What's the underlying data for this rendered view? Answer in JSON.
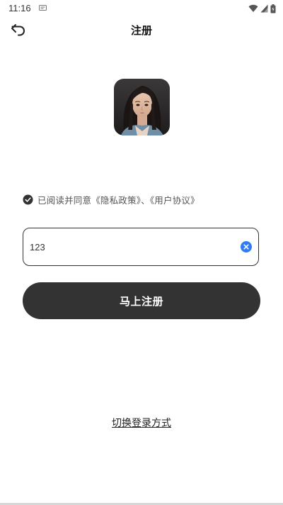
{
  "status_bar": {
    "time": "11:16",
    "icons": [
      "notification-icon",
      "wifi-icon",
      "signal-icon",
      "battery-icon"
    ]
  },
  "header": {
    "title": "注册",
    "back_icon": "back-arrow-icon"
  },
  "avatar": {
    "icon": "app-avatar"
  },
  "agreement": {
    "checked": true,
    "prefix": "已阅读并同意",
    "privacy_link": "《隐私政策》",
    "separator": "、",
    "user_agreement_link": "《用户协议》"
  },
  "input": {
    "value": "123",
    "clear_icon": "clear-icon"
  },
  "register_button": {
    "label": "马上注册"
  },
  "switch_login": {
    "label": "切换登录方式"
  },
  "colors": {
    "primary_dark": "#333333",
    "clear_blue": "#2e7cf6",
    "background": "#ffffff"
  }
}
